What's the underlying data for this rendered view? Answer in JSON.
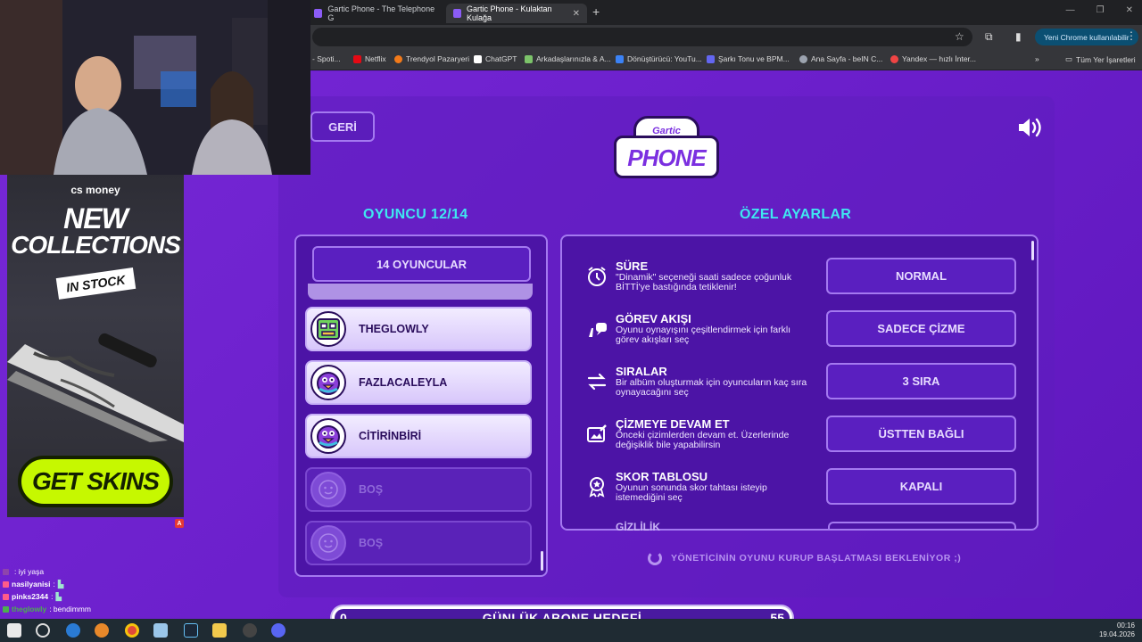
{
  "browser": {
    "tabs": [
      {
        "label": "Gartic Phone - The Telephone G"
      },
      {
        "label": "Gartic Phone - Kulaktan Kulağa"
      }
    ],
    "chrome_button": "Yeni Chrome kullanılabilir",
    "bookmarks": [
      {
        "label": "- Spoti...",
        "color": "#1db954"
      },
      {
        "label": "Netflix",
        "color": "#e50914"
      },
      {
        "label": "Trendyol Pazaryeri",
        "color": "#f27a1a"
      },
      {
        "label": "ChatGPT",
        "color": "#ffffff"
      },
      {
        "label": "Arkadaşlarınızla & A...",
        "color": "#7cc36a"
      },
      {
        "label": "Dönüştürücü: YouTu...",
        "color": "#3b82f6"
      },
      {
        "label": "Şarkı Tonu ve BPM...",
        "color": "#6366f1"
      },
      {
        "label": "Ana Sayfa - beIN C...",
        "color": "#9ca3af"
      },
      {
        "label": "Yandex — hızlı İnter...",
        "color": "#ef4444"
      }
    ],
    "all_bookmarks": "Tüm Yer İşaretleri"
  },
  "game": {
    "back_label": "GERİ",
    "logo_top": "Gartic",
    "logo_bottom": "PHONE",
    "players_title": "OYUNCU 12/14",
    "players_button": "14 OYUNCULAR",
    "players": [
      {
        "name": "THEGLOWLY",
        "state": "filled",
        "avatar_color": "#6fd35c"
      },
      {
        "name": "FAZLACALEYLA",
        "state": "filled",
        "avatar_color": "#8b3fd9"
      },
      {
        "name": "CİTİRİNBİRİ",
        "state": "filled",
        "avatar_color": "#8b3fd9"
      },
      {
        "name": "BOŞ",
        "state": "empty"
      },
      {
        "name": "BOŞ",
        "state": "empty"
      }
    ],
    "settings_title": "ÖZEL AYARLAR",
    "settings": [
      {
        "icon": "alarm-clock-icon",
        "title": "SÜRE",
        "desc": "\"Dinamik\" seçeneği saati sadece çoğunluk BİTTİ'ye bastığında tetiklenir!",
        "value": "NORMAL"
      },
      {
        "icon": "task-flow-icon",
        "title": "GÖREV AKIŞI",
        "desc": "Oyunu oynayışını çeşitlendirmek için farklı görev akışları seç",
        "value": "SADECE ÇİZME"
      },
      {
        "icon": "swap-arrows-icon",
        "title": "SIRALAR",
        "desc": "Bir albüm oluşturmak için oyuncuların kaç sıra oynayacağını seç",
        "value": "3 SIRA"
      },
      {
        "icon": "edit-drawing-icon",
        "title": "ÇİZMEYE DEVAM ET",
        "desc": "Önceki çizimlerden devam et. Üzerlerinde değişiklik bile yapabilirsin",
        "value": "ÜSTTEN BAĞLI"
      },
      {
        "icon": "medal-icon",
        "title": "SKOR TABLOSU",
        "desc": "Oyunun sonunda skor tahtası isteyip istemediğini seç",
        "value": "KAPALI"
      }
    ],
    "settings_cut": "GİZLİLİK",
    "waiting": "YÖNETİCİNİN OYUNU KURUP BAŞLATMASI BEKLENİYOR ;)"
  },
  "ad": {
    "brand": "cs money",
    "headline_1": "NEW",
    "headline_2": "COLLECTIONS",
    "stock": "IN STOCK",
    "cta": "GET SKINS",
    "badge": "A"
  },
  "chat": [
    {
      "user": "",
      "message": ": iyi yaşa",
      "color": "#9b59b6"
    },
    {
      "user": "nasilyanisi",
      "message": ":",
      "color": "#ffffff"
    },
    {
      "user": "pinks2344",
      "message": ":",
      "color": "#ffffff"
    },
    {
      "user": "theglowly",
      "message": ": bendimmm",
      "color": "#4caf50"
    }
  ],
  "goal": {
    "label": "GÜNLÜK ABONE HEDEFİ",
    "min": "0",
    "max": "55",
    "progress": 0.0
  },
  "taskbar": {
    "time": "00:16",
    "date": "19.04.2026"
  }
}
